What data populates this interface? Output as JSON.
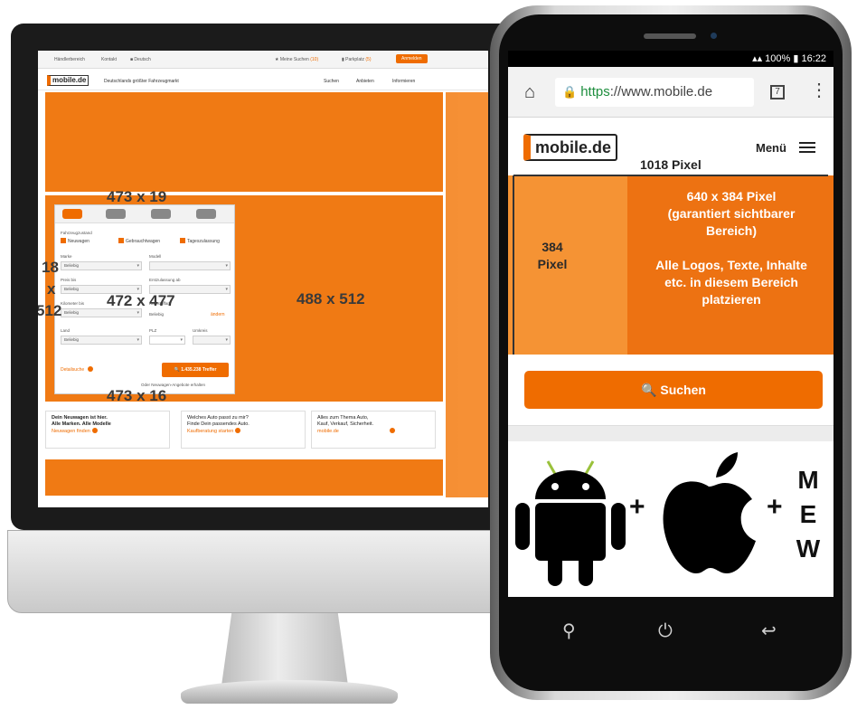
{
  "desktop": {
    "topbar": {
      "item1": "Händlerbereich",
      "item2": "Kontakt",
      "language": "Deutsch",
      "saved_searches": "Meine Suchen",
      "saved_searches_count": "(10)",
      "parked": "Parkplatz",
      "parked_count": "(5)",
      "login": "Anmelden"
    },
    "header": {
      "logo": "mobile.de",
      "tagline": "Deutschlands größter Fahrzeugmarkt",
      "nav": [
        "Suchen",
        "Anbieten",
        "Informieren"
      ]
    },
    "search_card": {
      "condition_label": "Fahrzeugzustand",
      "checks": [
        "Neuwagen",
        "Gebrauchtwagen",
        "Tageszulassung"
      ],
      "make_label": "Marke",
      "make_value": "Beliebig",
      "model_label": "Modell",
      "price_label": "Preis bis",
      "price_value": "Beliebig",
      "reg_label": "Erstzulassung ab",
      "km_label": "Kilometer bis",
      "km_value": "Beliebig",
      "fuel_label": "Kraftstoffart",
      "fuel_value": "Beliebig",
      "fuel_change": "ändern",
      "country_label": "Land",
      "country_value": "Beliebig",
      "zip_label": "PLZ",
      "radius_label": "Umkreis",
      "detail_search": "Detailsuche",
      "results_button": "1.435.238 Treffer",
      "alert_text": "Oder Neuwagen-Angebote erhalten"
    },
    "dimensions": {
      "tabs": "473 x 19",
      "card": "472 x 477",
      "bottom": "473 x 16",
      "banner": "488 x 512",
      "side_a": "18",
      "side_b": "x",
      "side_c": "512"
    },
    "info_boxes": [
      {
        "line1": "Dein Neuwagen ist hier.",
        "line2": "Alle Marken. Alle Modelle",
        "link": "Neuwagen finden"
      },
      {
        "line1": "Welches Auto passt zu mir?",
        "line2": "Finde Dein passendes Auto.",
        "link": "Kaufberatung starten"
      },
      {
        "line1": "Alles zum Thema Auto,",
        "line2": "Kauf, Verkauf, Sicherheit.",
        "link": "mobile.de"
      }
    ]
  },
  "phone": {
    "status": "100% ▮ 16:22",
    "url_https": "https",
    "url_rest": "://www.mobile.de",
    "tab_count": "7",
    "logo": "mobile.de",
    "menu": "Menü",
    "width_label": "1018 Pixel",
    "height_line1": "384",
    "height_line2": "Pixel",
    "hero_lines": [
      "640 x 384 Pixel",
      "(garantiert sichtbarer",
      "Bereich)",
      "",
      "Alle Logos, Texte, Inhalte",
      "etc. in diesem Bereich",
      "platzieren"
    ],
    "search_button": "Suchen",
    "plus1": "+",
    "plus2": "+",
    "mew": [
      "M",
      "E",
      "W"
    ]
  },
  "colors": {
    "brand_orange": "#ef6c00",
    "hero_light": "#f59334",
    "hero_dark": "#ed7212"
  }
}
